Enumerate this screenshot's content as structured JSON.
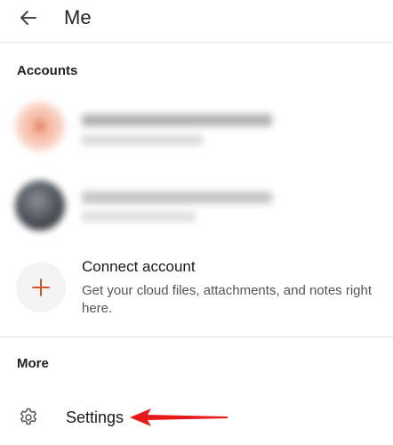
{
  "header": {
    "title": "Me",
    "back_icon": "arrow-left-icon"
  },
  "accounts": {
    "label": "Accounts",
    "items": [
      {
        "avatar_initial": "A",
        "accent": "#d96a48"
      },
      {
        "avatar_initial": ""
      }
    ]
  },
  "connect": {
    "title": "Connect account",
    "description": "Get your cloud files, attachments, and notes right here.",
    "icon": "plus-icon",
    "icon_color": "#d35230"
  },
  "more": {
    "label": "More",
    "settings_label": "Settings",
    "settings_icon": "gear-icon"
  },
  "annotation": {
    "color": "#e8191b"
  }
}
